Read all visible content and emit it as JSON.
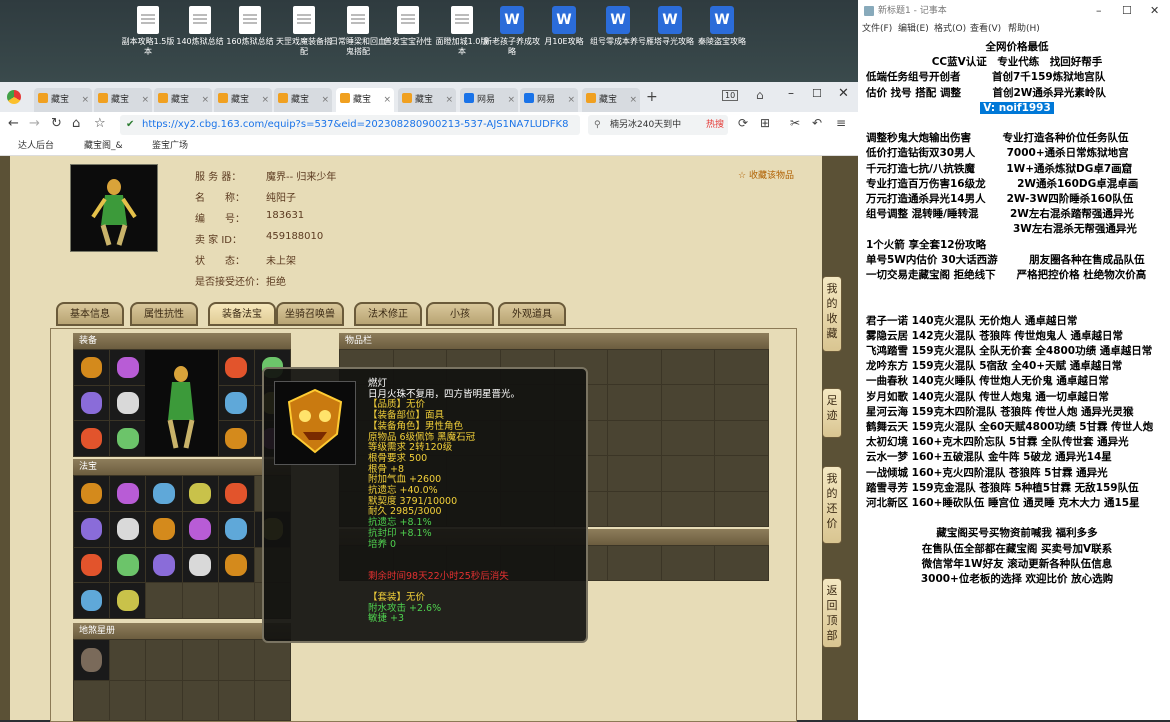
{
  "desktop": {
    "icons": [
      {
        "label": "副本攻略1.5版本",
        "type": "txt"
      },
      {
        "label": "140炼狱总结",
        "type": "txt"
      },
      {
        "label": "160炼狱总结",
        "type": "txt"
      },
      {
        "label": "天罡戏魔装备搭配",
        "type": "txt"
      },
      {
        "label": "日常睡梁和回血鬼搭配",
        "type": "txt"
      },
      {
        "label": "普发宝宝孙性",
        "type": "txt"
      },
      {
        "label": "面瞪加城1.0版本",
        "type": "txt"
      },
      {
        "label": "新老孩子养成攻略",
        "type": "doc"
      },
      {
        "label": "月10E攻略",
        "type": "doc"
      },
      {
        "label": "组号零成本养号",
        "type": "doc"
      },
      {
        "label": "雁塔寻光攻略",
        "type": "doc"
      },
      {
        "label": "秦陵盗宝攻略",
        "type": "doc"
      }
    ]
  },
  "browser": {
    "tabs": [
      {
        "label": "藏宝"
      },
      {
        "label": "藏宝"
      },
      {
        "label": "藏宝"
      },
      {
        "label": "藏宝"
      },
      {
        "label": "藏宝"
      },
      {
        "label": "藏宝"
      },
      {
        "label": "藏宝"
      },
      {
        "label": "网易"
      },
      {
        "label": "网易"
      },
      {
        "label": "藏宝"
      }
    ],
    "tab_count": "10",
    "url": "https://xy2.cbg.163.com/equip?s=537&eid=202308280900213-537-AJS1NA7LUDFK8",
    "search_text": "楠另冰240天到中",
    "search_hot": "热搜",
    "bookmarks": [
      "达人后台",
      "藏宝阁_&",
      "鉴宝广场"
    ]
  },
  "info": {
    "rows": [
      {
        "label": "服 务 器：",
        "value": "魔界-- 归来少年"
      },
      {
        "label": "名　　称：",
        "value": "纯阳子"
      },
      {
        "label": "编　　号：",
        "value": "183631"
      },
      {
        "label": "卖 家 ID：",
        "value": "459188010"
      },
      {
        "label": "状　　态：",
        "value": "未上架"
      },
      {
        "label": "是否接受还价：",
        "value": "拒绝"
      }
    ],
    "fav": "收藏该物品"
  },
  "page_tabs": [
    "基本信息",
    "属性抗性",
    "装备法宝",
    "坐骑召唤兽",
    "法术修正",
    "小孩",
    "外观道具"
  ],
  "sections": {
    "equip": "装备",
    "fabao": "法宝",
    "dizhi": "地煞星册",
    "items": "物品栏"
  },
  "tooltip": {
    "lines": [
      {
        "text": "燃灯",
        "color": "#ffffff"
      },
      {
        "text": "日月火珠不复用，四方皆明星晋光。",
        "color": "#ffffff"
      },
      {
        "text": "【品质】无价",
        "color": "#f2d03a"
      },
      {
        "text": "【装备部位】面具",
        "color": "#f2d03a"
      },
      {
        "text": "【装备角色】男性角色",
        "color": "#f2d03a"
      },
      {
        "text": "原物品 6级佩饰 黑魔石冠",
        "color": "#f2d03a"
      },
      {
        "text": "等级需求 2转120级",
        "color": "#f2d03a"
      },
      {
        "text": "根骨要求 500",
        "color": "#f2d03a"
      },
      {
        "text": "根骨 +8",
        "color": "#f2d03a"
      },
      {
        "text": "附加气血 +2600",
        "color": "#f2d03a"
      },
      {
        "text": "抗遗忘 +40.0%",
        "color": "#f2d03a"
      },
      {
        "text": "默契度 3791/10000",
        "color": "#f2d03a"
      },
      {
        "text": "耐久 2985/3000",
        "color": "#f2d03a"
      },
      {
        "text": "抗遗忘 +8.1%",
        "color": "#4fd14f"
      },
      {
        "text": "抗封印 +8.1%",
        "color": "#4fd14f"
      },
      {
        "text": "培养 0",
        "color": "#4fd14f"
      },
      {
        "text": "",
        "color": "#ffffff"
      },
      {
        "text": "",
        "color": "#ffffff"
      },
      {
        "text": "剩余时间98天22小时25秒后消失",
        "color": "#e03030"
      },
      {
        "text": "",
        "color": "#ffffff"
      },
      {
        "text": "【套装】无价",
        "color": "#f2d03a"
      },
      {
        "text": "附水攻击 +2.6%",
        "color": "#4fd14f"
      },
      {
        "text": "敏捷 +3",
        "color": "#4fd14f"
      }
    ]
  },
  "side_buttons": [
    "我的收藏",
    "足迹",
    "我的还价",
    "返回顶部"
  ],
  "notepad": {
    "title": "新标题1 - 记事本",
    "menu": [
      "文件(F)",
      "编辑(E)",
      "格式(O)",
      "查看(V)",
      "帮助(H)"
    ],
    "lines": [
      {
        "text": "全网价格最低",
        "align": "center",
        "highlight": false
      },
      {
        "text": "CC蓝V认证　专业代练　找回好帮手",
        "align": "center",
        "highlight": false
      },
      {
        "text": "低端任务组号开创者　　　首创7千159炼狱地宫队",
        "align": "left",
        "highlight": false
      },
      {
        "text": "估价 找号 搭配 调整　　　首创2W通杀异光素岭队",
        "align": "left",
        "highlight": false
      },
      {
        "text": "V: noif1993",
        "align": "center",
        "highlight": true
      },
      {
        "text": "",
        "align": "left",
        "highlight": false
      },
      {
        "text": "调整秒鬼大炮输出伤害　　　专业打造各种价位任务队伍",
        "align": "left",
        "highlight": false
      },
      {
        "text": "低价打造钻街双30男人　　　7000+通杀日常炼狱地宫",
        "align": "left",
        "highlight": false
      },
      {
        "text": "千元打造七抗/八抗铁魔　　　1W+通杀炼狱DG卓7画窟",
        "align": "left",
        "highlight": false
      },
      {
        "text": "专业打造百万伤害16级龙　　　2W通杀160DG卓混卓画",
        "align": "left",
        "highlight": false
      },
      {
        "text": "万元打造通杀异光14男人　　2W-3W四阶睡杀160队伍",
        "align": "left",
        "highlight": false
      },
      {
        "text": "组号调整 混转睡/睡转混　　　2W左右混杀踏帮强通异光",
        "align": "left",
        "highlight": false
      },
      {
        "text": "　　　　　　　　　　　　　　3W左右混杀无帮强通异光",
        "align": "left",
        "highlight": false
      },
      {
        "text": "1个火箭 享全套12份攻略",
        "align": "left",
        "highlight": false
      },
      {
        "text": "单号5W内估价 30大话西游　　　朋友圈各种在售成品队伍",
        "align": "left",
        "highlight": false
      },
      {
        "text": "一切交易走藏宝阁 拒绝线下　　严格把控价格 杜绝物次价高",
        "align": "left",
        "highlight": false
      },
      {
        "text": "",
        "align": "left",
        "highlight": false
      },
      {
        "text": "",
        "align": "left",
        "highlight": false
      },
      {
        "text": "君子一诺 140克火混队 无价炮人 通卓越日常",
        "align": "left",
        "highlight": false
      },
      {
        "text": "雾隐云居 142克火混队 苍狼阵 传世炮鬼人 通卓越日常",
        "align": "left",
        "highlight": false
      },
      {
        "text": "飞鸿踏雪 159克火混队 全队无价套 全4800功绩 通卓越日常",
        "align": "left",
        "highlight": false
      },
      {
        "text": "龙吟东方 159克火混队 5宿敌 全40+天赋 通卓越日常",
        "align": "left",
        "highlight": false
      },
      {
        "text": "一曲春秋 140克火睡队 传世炮人无价鬼 通卓越日常",
        "align": "left",
        "highlight": false
      },
      {
        "text": "岁月如歌 140克火混队 传世人炮鬼 通一切卓越日常",
        "align": "left",
        "highlight": false
      },
      {
        "text": "星河云海 159克木四阶混队 苍狼阵 传世人炮 通异光灵猴",
        "align": "left",
        "highlight": false
      },
      {
        "text": "鹤舞云天 159克火混队 全60天赋4800功绩 5甘霖 传世人炮",
        "align": "left",
        "highlight": false
      },
      {
        "text": "太初幻境 160+克木四阶忘队 5甘霖 全队传世套 通异光",
        "align": "left",
        "highlight": false
      },
      {
        "text": "云水一梦 160+五破混队 金牛阵 5破龙 通异光14星",
        "align": "left",
        "highlight": false
      },
      {
        "text": "一战倾城 160+克火四阶混队 苍狼阵 5甘霖 通异光",
        "align": "left",
        "highlight": false
      },
      {
        "text": "踏雪寻芳 159克金混队 苍狼阵 5种植5甘霖 无敌159队伍",
        "align": "left",
        "highlight": false
      },
      {
        "text": "河北新区 160+睡砍队伍 睡宫位 通灵睡 克木大力 通15星",
        "align": "left",
        "highlight": false
      },
      {
        "text": "",
        "align": "left",
        "highlight": false
      },
      {
        "text": "藏宝阁买号买物资前喊我 福利多多",
        "align": "center",
        "highlight": false
      },
      {
        "text": "在售队伍全部都在藏宝阁 买卖号加V联系",
        "align": "center",
        "highlight": false
      },
      {
        "text": "微信常年1W好友 滚动更新各种队伍信息",
        "align": "center",
        "highlight": false
      },
      {
        "text": "3000+位老板的选择 欢迎比价 放心选购",
        "align": "center",
        "highlight": false
      }
    ]
  }
}
